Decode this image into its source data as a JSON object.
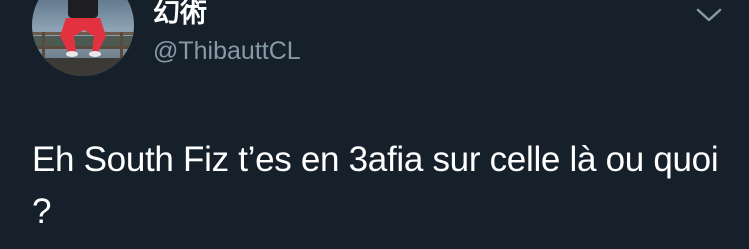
{
  "tweet": {
    "display_name": "幻術",
    "handle": "@ThibauttCL",
    "text": "Eh South Fiz t’es en 3afia sur celle là ou quoi ?",
    "avatar_icon": "profile-photo-person-crouching",
    "menu_icon": "chevron-down-icon"
  },
  "colors": {
    "background": "#15202b",
    "primary_text": "#ffffff",
    "secondary_text": "#8899a6"
  }
}
